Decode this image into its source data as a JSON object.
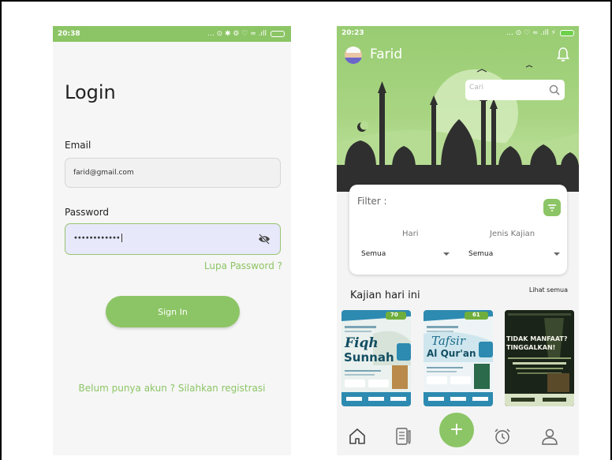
{
  "login_screen": {
    "status_time": "20:38",
    "status_icons": "... ⊙ ✱ ⚙ ♡ ≈ .ıll",
    "title": "Login",
    "email_label": "Email",
    "email_value": "farid@gmail.com",
    "password_label": "Password",
    "password_value": "••••••••••••",
    "forgot_password": "Lupa Password ?",
    "sign_in_label": "Sign In",
    "register_text": "Belum punya akun ? Silahkan registrasi"
  },
  "home_screen": {
    "status_time": "20:23",
    "status_icons": "... ⊙ ♡ ≈ .ıll ⚡",
    "user_name": "Farid",
    "search_placeholder": "Cari",
    "filter_label": "Filter :",
    "filter_hari_label": "Hari",
    "filter_jenis_label": "Jenis Kajian",
    "filter_hari_value": "Semua",
    "filter_jenis_value": "Semua",
    "section_title": "Kajian hari ini",
    "see_all": "Lihat semua",
    "posters": [
      {
        "title_line1": "Fiqh",
        "title_line2": "Sunnah",
        "badge": "70"
      },
      {
        "title_line1": "Tafsir",
        "title_line2": "Al Qur'an",
        "badge": "61"
      },
      {
        "title_line1": "TIDAK MANFAAT?",
        "title_line2": "TINGGALKAN!"
      }
    ],
    "fab_label": "+",
    "nav_icons": [
      "home-icon",
      "notes-icon",
      "alarm-icon",
      "profile-icon"
    ]
  },
  "colors": {
    "brand_green": "#8cc565",
    "input_focus_bg": "#e8e8fb",
    "text_dark": "#222222"
  }
}
